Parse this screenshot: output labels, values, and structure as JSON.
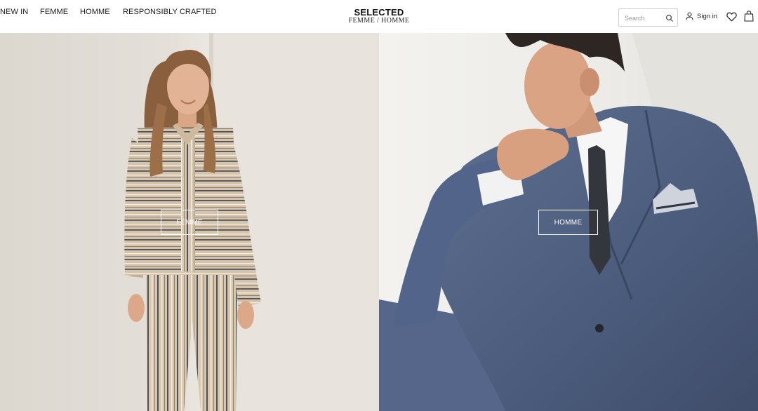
{
  "header": {
    "nav": [
      "NEW IN",
      "FEMME",
      "HOMME",
      "RESPONSIBLY CRAFTED"
    ],
    "logo": {
      "main": "SELECTED",
      "sub": "FEMME / HOMME"
    },
    "search": {
      "placeholder": "Search",
      "icon": "search-icon"
    },
    "sign_in": {
      "label": "Sign in",
      "icon": "user-icon"
    },
    "icons": [
      "heart-icon",
      "bag-icon"
    ]
  },
  "hero": {
    "femme": {
      "cta_label": "FEMME"
    },
    "homme": {
      "cta_label": "HOMME"
    }
  }
}
